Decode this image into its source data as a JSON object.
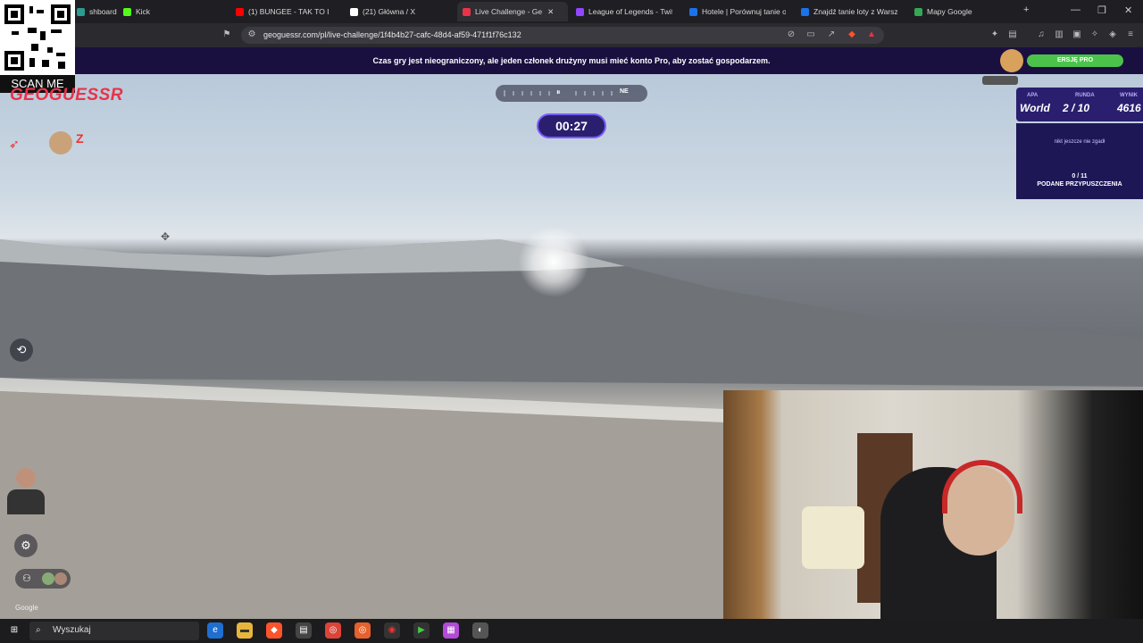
{
  "browser": {
    "tabs": [
      {
        "label": "shboard",
        "color": "#2a9d8f"
      },
      {
        "label": "Kick",
        "color": "#53fc18"
      },
      {
        "label": "(1) BUNGEE - TAK TO I",
        "color": "#ff0000"
      },
      {
        "label": "(21) Główna / X",
        "color": "#ffffff"
      },
      {
        "label": "Live Challenge - Ge",
        "color": "#e8334a"
      },
      {
        "label": "League of Legends - Twitc",
        "color": "#9146ff"
      },
      {
        "label": "Hotele | Porównuj tanie of",
        "color": "#1a73e8"
      },
      {
        "label": "Znajdź tanie loty z Warsz",
        "color": "#1a73e8"
      },
      {
        "label": "Mapy Google",
        "color": "#34a853"
      }
    ],
    "url": "geoguessr.com/pl/live-challenge/1f4b4b27-cafc-48d4-af59-471f1f76c132"
  },
  "banner": {
    "text": "Czas gry jest nieograniczony, ale jeden członek drużyny musi mieć konto Pro, aby zostać gospodarzem.",
    "pro_button": "ERSJĘ PRO"
  },
  "overlay": {
    "scan_me": "SCAN ME"
  },
  "game": {
    "logo": "GEOGUESSR",
    "timer": "00:27",
    "map_label": "APA",
    "map_value": "World",
    "round_label": "RUNDA",
    "round_value": "2 / 10",
    "score_label": "WYNIK",
    "score_value": "4616",
    "nobody_guessed": "nikt jeszcze nie zgadł",
    "guesses_count": "0 / 11",
    "guesses_label": "PODANE PRZYPUSZCZENIA",
    "google": "Google"
  },
  "taskbar": {
    "search": "Wyszukaj"
  }
}
